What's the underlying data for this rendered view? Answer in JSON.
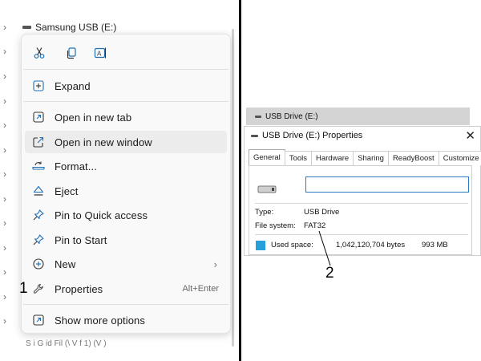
{
  "explorer": {
    "usb_item": "Samsung USB (E:)",
    "bottom_cut_text": "S   i  G  id  Fil   (\\ V   f  1) (V  )"
  },
  "context_menu": {
    "quick_actions": [
      {
        "icon": "scissors-icon",
        "name": "cut"
      },
      {
        "icon": "copy-icon",
        "name": "copy"
      },
      {
        "icon": "rename-icon",
        "name": "rename"
      }
    ],
    "items": [
      {
        "label": "Expand",
        "icon": "expand-icon"
      },
      {
        "label": "Open in new tab",
        "icon": "open-new-tab-icon"
      },
      {
        "label": "Open in new window",
        "icon": "open-new-window-icon"
      },
      {
        "label": "Format...",
        "icon": "format-icon"
      },
      {
        "label": "Eject",
        "icon": "eject-icon"
      },
      {
        "label": "Pin to Quick access",
        "icon": "pin-icon"
      },
      {
        "label": "Pin to Start",
        "icon": "pin-icon"
      },
      {
        "label": "New",
        "icon": "new-icon"
      },
      {
        "label": "Properties",
        "icon": "wrench-icon",
        "accelerator": "Alt+Enter"
      },
      {
        "label": "Show more options",
        "icon": "more-options-icon"
      }
    ],
    "hovered_item": "Open in new window"
  },
  "callouts": {
    "one": "1",
    "two": "2"
  },
  "properties_dialog": {
    "background_window_title": "USB Drive (E:)",
    "title": "USB Drive (E:) Properties",
    "close_glyph": "✕",
    "tabs": [
      "General",
      "Tools",
      "Hardware",
      "Sharing",
      "ReadyBoost",
      "Customize"
    ],
    "active_tab": "General",
    "name_value": "",
    "type_label": "Type:",
    "type_value": "USB Drive",
    "fs_label": "File system:",
    "fs_value": "FAT32",
    "used_label": "Used space:",
    "used_bytes": "1,042,120,704 bytes",
    "used_size": "993 MB"
  },
  "colors": {
    "accent": "#2a7ac5",
    "used_space": "#26a0da",
    "menu_bg": "#f9f9f9",
    "hover": "#ececec"
  }
}
